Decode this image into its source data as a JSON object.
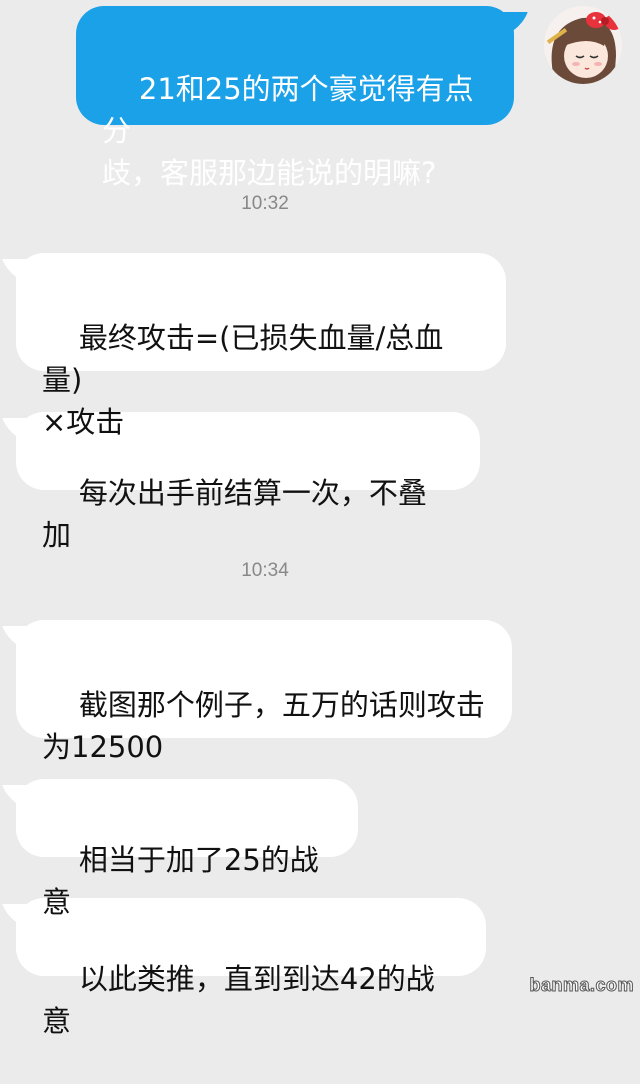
{
  "messages": [
    {
      "type": "outgoing",
      "text": "21和25的两个豪觉得有点分\n歧，客服那边能说的明嘛?"
    },
    {
      "type": "time",
      "text": "10:32"
    },
    {
      "type": "incoming",
      "text": "最终攻击=(已损失血量/总血量)\n×攻击"
    },
    {
      "type": "incoming",
      "text": "每次出手前结算一次，不叠加"
    },
    {
      "type": "time",
      "text": "10:34"
    },
    {
      "type": "incoming",
      "text": "截图那个例子，五万的话则攻击\n为12500"
    },
    {
      "type": "incoming",
      "text": "相当于加了25的战意"
    },
    {
      "type": "incoming",
      "text": "以此类推，直到到达42的战意"
    }
  ],
  "avatar": {
    "icon": "hello-kitty-bow-avatar-icon"
  },
  "watermark": "banma.com",
  "colors": {
    "background": "#ebebeb",
    "outgoing_bubble": "#1ba1e8",
    "incoming_bubble": "#ffffff",
    "timestamp": "#888888"
  }
}
